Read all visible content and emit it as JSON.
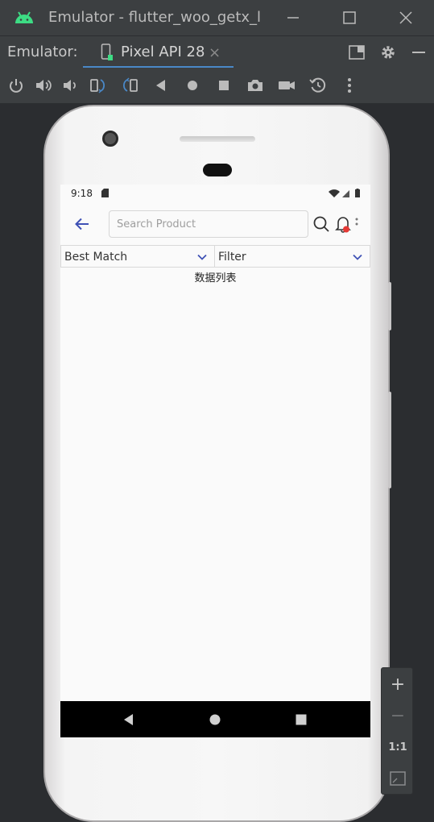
{
  "window": {
    "title": "Emulator - flutter_woo_getx_le",
    "colors": {
      "titlebar": "#3c3f41",
      "android_green": "#3ddc84",
      "tab_underline": "#4a88c7"
    }
  },
  "tool_window": {
    "label": "Emulator:",
    "tab_label": "Pixel API 28",
    "tab_close": "×"
  },
  "zoom": {
    "zoom_in": "+",
    "zoom_out": "−",
    "actual_size": "1:1"
  },
  "device": {
    "status_bar": {
      "time": "9:18"
    },
    "app": {
      "search_placeholder": "Search Product",
      "sort_dropdown": "Best Match",
      "filter_dropdown": "Filter",
      "content_text": "数据列表",
      "accent_color": "#3f51b5",
      "badge_color": "#e53935"
    }
  }
}
